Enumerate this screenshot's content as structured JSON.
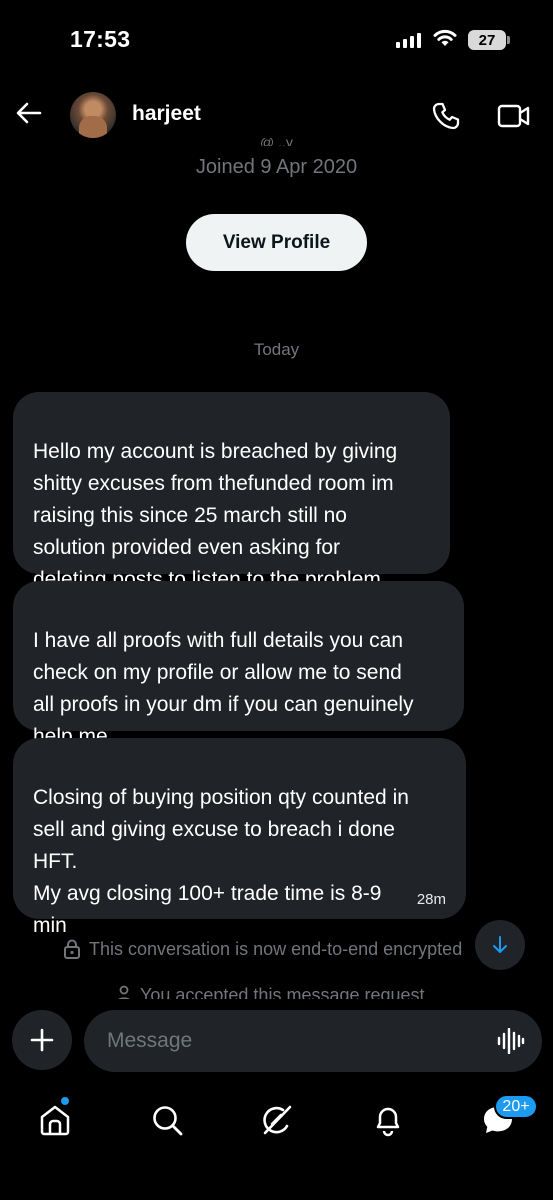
{
  "status_bar": {
    "time": "17:53",
    "battery": "27"
  },
  "header": {
    "contact_name": "harjeet",
    "icons": [
      "back-arrow-icon",
      "phone-icon",
      "video-camera-icon"
    ]
  },
  "profile": {
    "cut_off_line": "@ ..y",
    "joined": "Joined 9 Apr 2020",
    "view_profile_label": "View Profile"
  },
  "conversation": {
    "day_label": "Today",
    "messages": [
      {
        "text": "Hello my account is breached by giving\nshitty excuses from thefunded room im\nraising this since 25 march still no\nsolution provided even asking for\ndeleting posts to listen to the problem",
        "time": ""
      },
      {
        "text": "I have all proofs with full details you can\ncheck on my profile or allow me to send\nall proofs in your dm if you can genuinely\nhelp me",
        "time": ""
      },
      {
        "text": "Closing of buying position qty counted in\nsell and giving excuse to breach i done\nHFT.\nMy avg closing 100+ trade time is 8-9\nmin",
        "time": "28m"
      }
    ],
    "encryption_notice": "This conversation is now end-to-end encrypted",
    "accepted_notice": "You accepted this message request"
  },
  "composer": {
    "placeholder": "Message"
  },
  "bottom_nav": {
    "items": [
      "home-icon",
      "search-icon",
      "grok-icon",
      "notifications-bell-icon",
      "messages-icon"
    ],
    "messages_badge": "20+",
    "accent_color": "#1d9bf0"
  }
}
